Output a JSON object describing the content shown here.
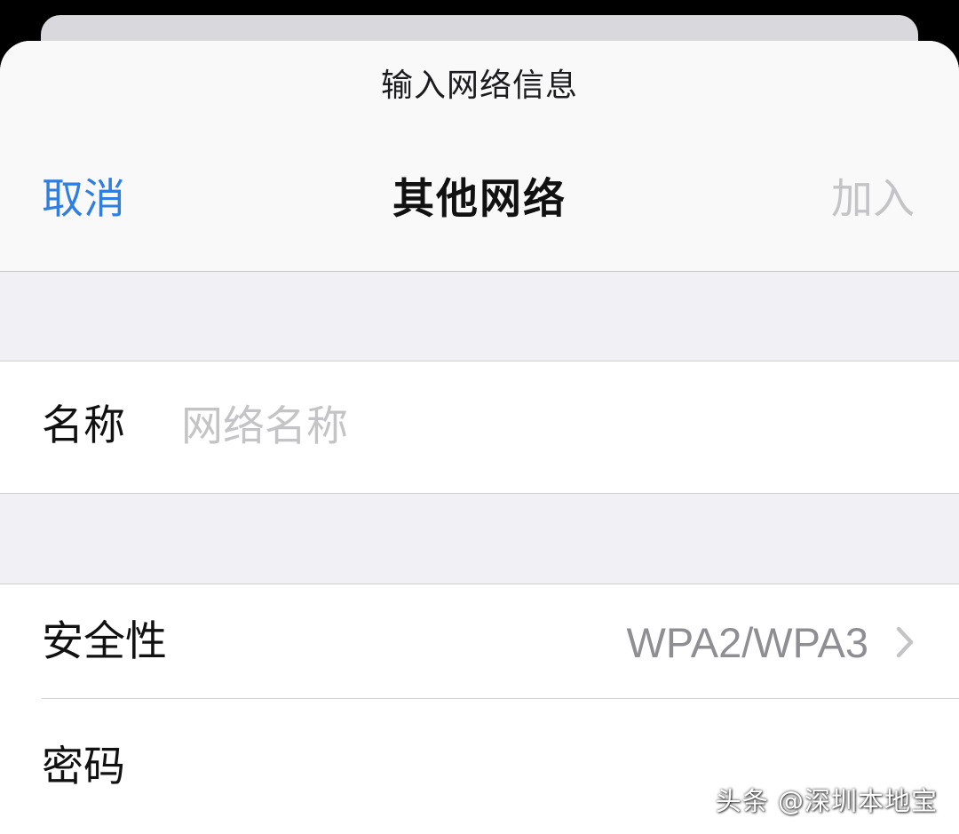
{
  "sheet": {
    "prompt": "输入网络信息"
  },
  "nav": {
    "cancel_label": "取消",
    "title": "其他网络",
    "join_label": "加入"
  },
  "name_row": {
    "label": "名称",
    "placeholder": "网络名称",
    "value": ""
  },
  "security_row": {
    "label": "安全性",
    "value": "WPA2/WPA3",
    "icon": "chevron-right-icon"
  },
  "password_row": {
    "label": "密码"
  },
  "watermark": {
    "text": "头条 @深圳本地宝"
  },
  "colors": {
    "accent": "#2f7ee0",
    "disabled": "#c4c4c6",
    "secondary_text": "#8e8e93",
    "grouped_background": "#f1f0f5"
  }
}
